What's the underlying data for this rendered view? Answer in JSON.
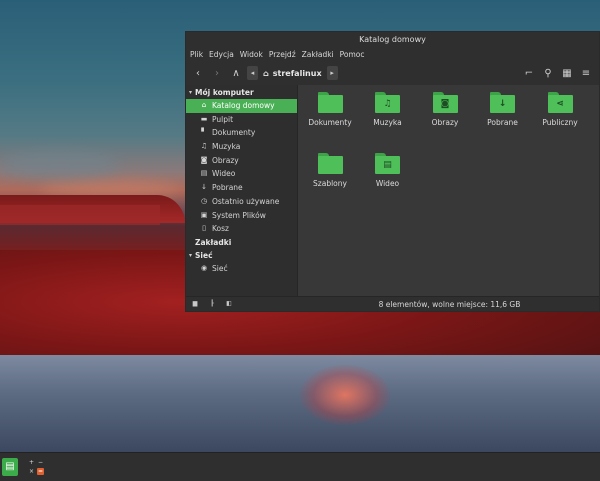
{
  "window": {
    "title": "Katalog domowy"
  },
  "menu": [
    "Plik",
    "Edycja",
    "Widok",
    "Przejdź",
    "Zakładki",
    "Pomoc"
  ],
  "toolbar": {
    "location": "strefalinux"
  },
  "sidebar": {
    "sections": [
      {
        "header": "Mój komputer",
        "items": [
          {
            "label": "Katalog domowy",
            "icon": "home-icon",
            "glyph": "⌂"
          },
          {
            "label": "Pulpit",
            "icon": "desktop-icon",
            "glyph": "▬"
          },
          {
            "label": "Dokumenty",
            "icon": "document-icon",
            "glyph": "▘"
          },
          {
            "label": "Muzyka",
            "icon": "music-icon",
            "glyph": "♫"
          },
          {
            "label": "Obrazy",
            "icon": "camera-icon",
            "glyph": "◙"
          },
          {
            "label": "Wideo",
            "icon": "film-icon",
            "glyph": "▤"
          },
          {
            "label": "Pobrane",
            "icon": "download-icon",
            "glyph": "↓"
          },
          {
            "label": "Ostatnio używane",
            "icon": "clock-icon",
            "glyph": "◷"
          },
          {
            "label": "System Plików",
            "icon": "drive-icon",
            "glyph": "▣"
          },
          {
            "label": "Kosz",
            "icon": "trash-icon",
            "glyph": "▯"
          }
        ]
      },
      {
        "header": "Zakładki",
        "items": []
      },
      {
        "header": "Sieć",
        "items": [
          {
            "label": "Sieć",
            "icon": "network-icon",
            "glyph": "◉"
          }
        ]
      }
    ]
  },
  "files": [
    {
      "label": "Dokumenty",
      "icon": "folder-documents-icon",
      "glyph": ""
    },
    {
      "label": "Muzyka",
      "icon": "folder-music-icon",
      "glyph": "♫"
    },
    {
      "label": "Obrazy",
      "icon": "folder-pictures-icon",
      "glyph": "◙"
    },
    {
      "label": "Pobrane",
      "icon": "folder-download-icon",
      "glyph": "↓"
    },
    {
      "label": "Publiczny",
      "icon": "folder-share-icon",
      "glyph": "⋖"
    },
    {
      "label": "Szablony",
      "icon": "folder-templates-icon",
      "glyph": ""
    },
    {
      "label": "Wideo",
      "icon": "folder-video-icon",
      "glyph": "▤"
    }
  ],
  "status": {
    "text": "8 elementów, wolne miejsce: 11,6 GB"
  },
  "colors": {
    "accent": "#49b055",
    "folder": "#4fbf59"
  }
}
